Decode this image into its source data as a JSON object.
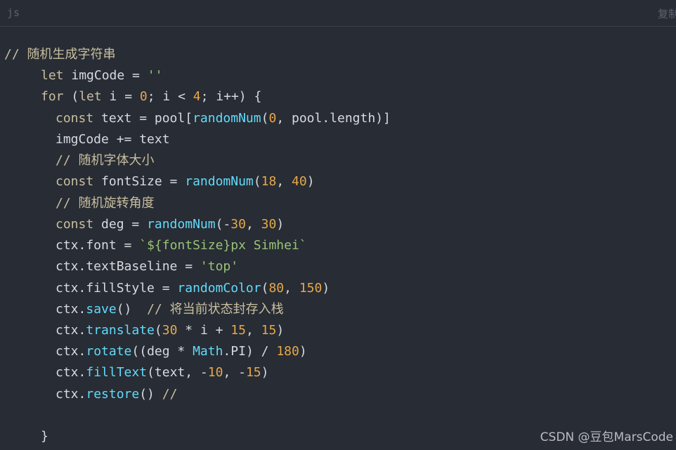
{
  "header": {
    "language": "js",
    "copy_label": "复制"
  },
  "code": {
    "lines": [
      [
        {
          "t": "// 随机生成字符串",
          "c": "cm"
        }
      ],
      [
        {
          "t": "let",
          "c": "kw"
        },
        {
          "t": " imgCode = "
        },
        {
          "t": "''",
          "c": "str"
        }
      ],
      [
        {
          "t": "for",
          "c": "kw"
        },
        {
          "t": " ("
        },
        {
          "t": "let",
          "c": "kw"
        },
        {
          "t": " i = "
        },
        {
          "t": "0",
          "c": "num"
        },
        {
          "t": "; i < "
        },
        {
          "t": "4",
          "c": "num"
        },
        {
          "t": "; i++) {"
        }
      ],
      [
        {
          "t": "const",
          "c": "kw"
        },
        {
          "t": " text = pool["
        },
        {
          "t": "randomNum",
          "c": "fn"
        },
        {
          "t": "("
        },
        {
          "t": "0",
          "c": "num"
        },
        {
          "t": ", pool.length)]"
        }
      ],
      [
        {
          "t": "imgCode += text"
        }
      ],
      [
        {
          "t": "// 随机字体大小",
          "c": "cm"
        }
      ],
      [
        {
          "t": "const",
          "c": "kw"
        },
        {
          "t": " fontSize = "
        },
        {
          "t": "randomNum",
          "c": "fn"
        },
        {
          "t": "("
        },
        {
          "t": "18",
          "c": "num"
        },
        {
          "t": ", "
        },
        {
          "t": "40",
          "c": "num"
        },
        {
          "t": ")"
        }
      ],
      [
        {
          "t": "// 随机旋转角度",
          "c": "cm"
        }
      ],
      [
        {
          "t": "const",
          "c": "kw"
        },
        {
          "t": " deg = "
        },
        {
          "t": "randomNum",
          "c": "fn"
        },
        {
          "t": "(-"
        },
        {
          "t": "30",
          "c": "num"
        },
        {
          "t": ", "
        },
        {
          "t": "30",
          "c": "num"
        },
        {
          "t": ")"
        }
      ],
      [
        {
          "t": "ctx.font = "
        },
        {
          "t": "`${fontSize}px Simhei`",
          "c": "str"
        }
      ],
      [
        {
          "t": "ctx.textBaseline = "
        },
        {
          "t": "'top'",
          "c": "str"
        }
      ],
      [
        {
          "t": "ctx.fillStyle = "
        },
        {
          "t": "randomColor",
          "c": "fn"
        },
        {
          "t": "("
        },
        {
          "t": "80",
          "c": "num"
        },
        {
          "t": ", "
        },
        {
          "t": "150",
          "c": "num"
        },
        {
          "t": ")"
        }
      ],
      [
        {
          "t": "ctx."
        },
        {
          "t": "save",
          "c": "fn"
        },
        {
          "t": "()  "
        },
        {
          "t": "// 将当前状态封存入栈",
          "c": "cm"
        }
      ],
      [
        {
          "t": "ctx."
        },
        {
          "t": "translate",
          "c": "fn"
        },
        {
          "t": "("
        },
        {
          "t": "30",
          "c": "num"
        },
        {
          "t": " * i + "
        },
        {
          "t": "15",
          "c": "num"
        },
        {
          "t": ", "
        },
        {
          "t": "15",
          "c": "num"
        },
        {
          "t": ")"
        }
      ],
      [
        {
          "t": "ctx."
        },
        {
          "t": "rotate",
          "c": "fn"
        },
        {
          "t": "((deg * "
        },
        {
          "t": "Math",
          "c": "fn"
        },
        {
          "t": ".PI) / "
        },
        {
          "t": "180",
          "c": "num"
        },
        {
          "t": ")"
        }
      ],
      [
        {
          "t": "ctx."
        },
        {
          "t": "fillText",
          "c": "fn"
        },
        {
          "t": "(text, -"
        },
        {
          "t": "10",
          "c": "num"
        },
        {
          "t": ", -"
        },
        {
          "t": "15",
          "c": "num"
        },
        {
          "t": ")"
        }
      ],
      [
        {
          "t": "ctx."
        },
        {
          "t": "restore",
          "c": "fn"
        },
        {
          "t": "() "
        },
        {
          "t": "//",
          "c": "cm"
        }
      ],
      [],
      [
        {
          "t": "}"
        }
      ]
    ]
  },
  "watermark": "CSDN @豆包MarsCode"
}
